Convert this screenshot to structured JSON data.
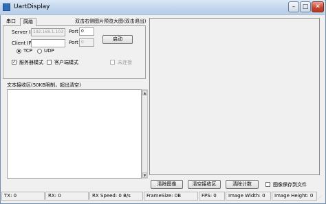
{
  "window": {
    "title": "UartDisplay",
    "controls": {
      "minimize": "–",
      "maximize": "□",
      "close": "✕"
    }
  },
  "tabs": [
    {
      "label": "串口",
      "active": false
    },
    {
      "label": "网络",
      "active": true
    }
  ],
  "network": {
    "server_ip_label": "Server IP",
    "server_ip_value": "192.168.1.103",
    "server_port_label": "Port",
    "server_port_value": "0",
    "start_button": "启动",
    "client_ip_label": "Client IP",
    "client_ip_value": "",
    "client_port_label": "Port",
    "client_port_value": "0",
    "protocol_options": [
      {
        "label": "TCP",
        "selected": true
      },
      {
        "label": "UDP",
        "selected": false
      }
    ],
    "server_mode_label": "服务器模式",
    "server_mode_checked": true,
    "client_mode_label": "客户端模式",
    "client_mode_checked": false,
    "disconnected_label": "未连接",
    "disconnected_checked": false
  },
  "preview_hint": "双击右侧图片预览大图(双击退出)",
  "receive_area": {
    "label": "文本接收区(50KB限制，超出清空)",
    "content": ""
  },
  "actions": {
    "clear_image": "清除图像",
    "clear_receive": "清空接收区",
    "clear_count": "清除计数",
    "save_image_label": "图像保存到文件",
    "save_image_checked": false
  },
  "status": {
    "tx": "TX: 0",
    "rx": "RX: 0",
    "rx_speed": "RX Speed: 0 B/s",
    "frame_size": "FrameSize: 0B",
    "fps": "FPS: 0",
    "image_width": "Image Width: 0",
    "image_height": "Image Height: 0"
  },
  "colors": {
    "close_button": "#c7442d",
    "titlebar": "#c2d6ec",
    "window_bg": "#f0f0f0"
  }
}
